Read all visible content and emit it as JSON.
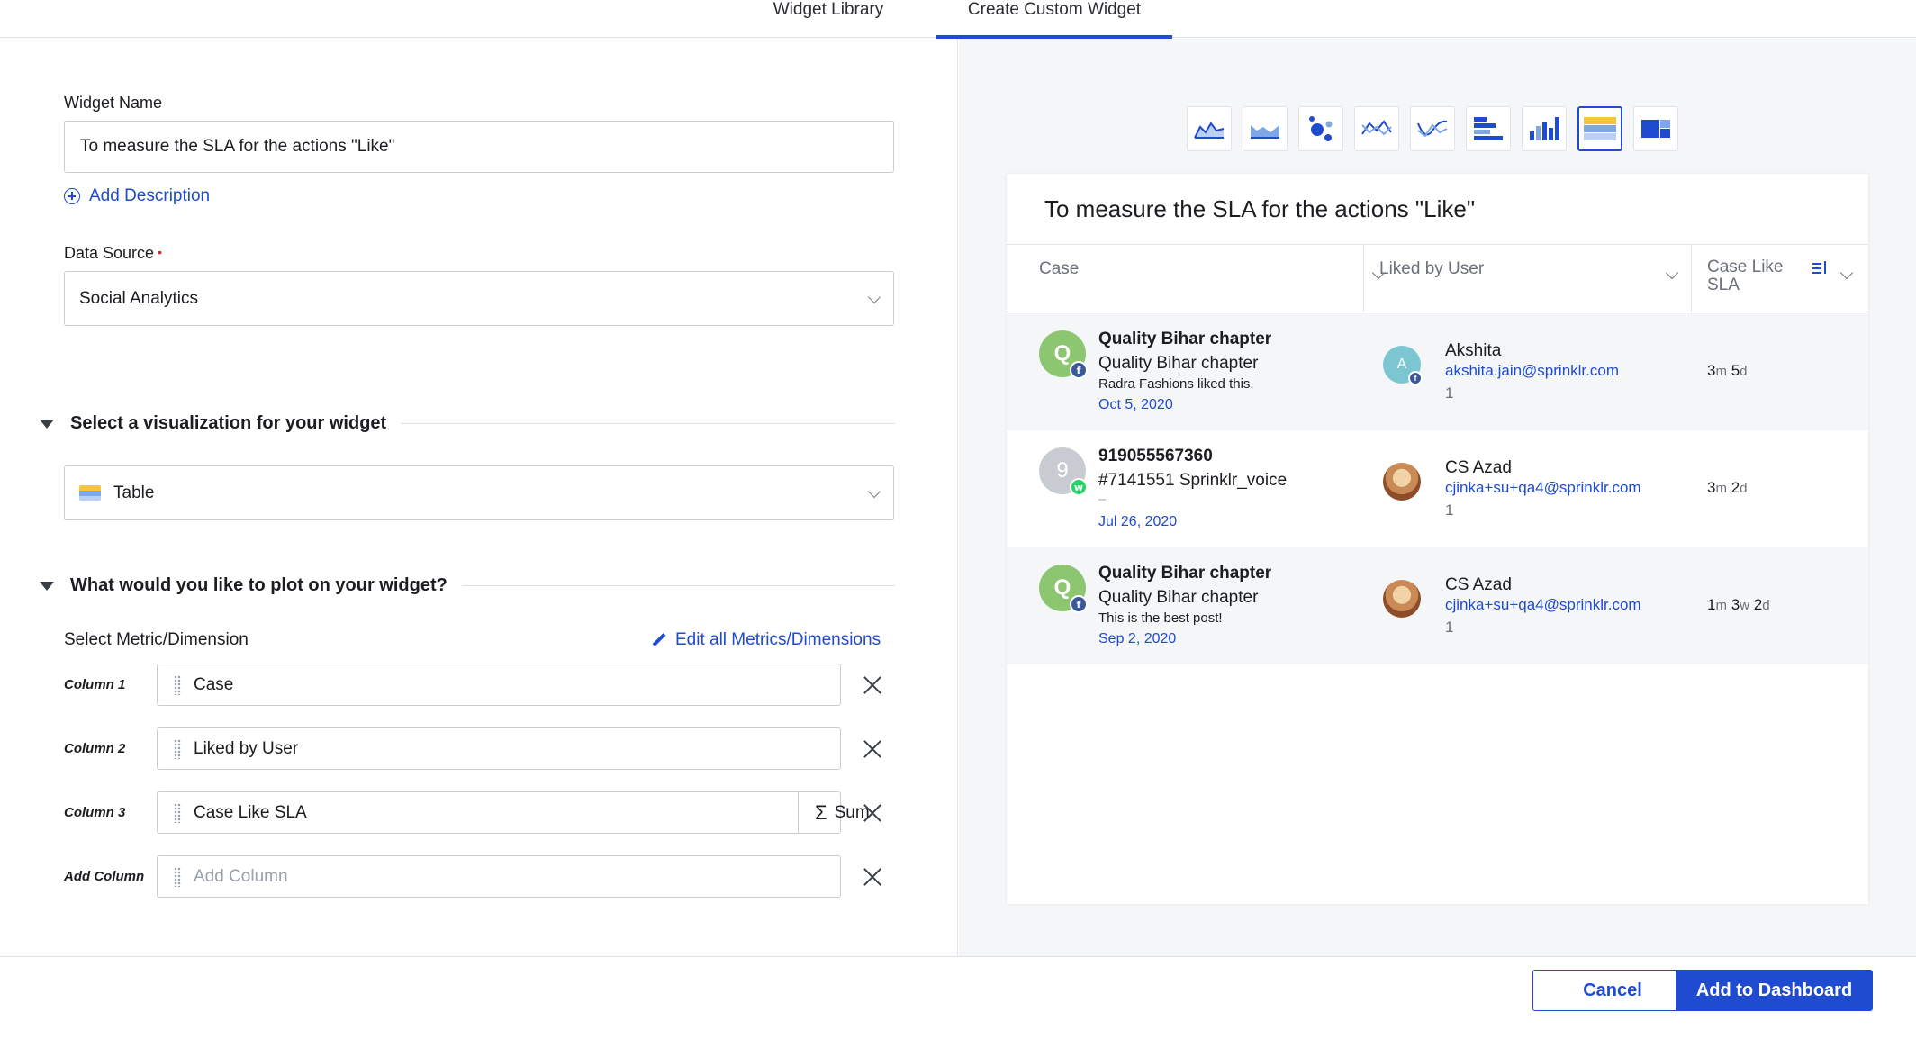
{
  "tabs": [
    {
      "label": "Widget Library"
    },
    {
      "label": "Create Custom Widget"
    }
  ],
  "form": {
    "widget_name_label": "Widget Name",
    "widget_name_value": "To measure the SLA for the actions \"Like\"",
    "add_description": "Add Description",
    "data_source_label": "Data Source",
    "data_source_required": "•",
    "data_source_value": "Social Analytics",
    "viz_section_title": "Select a visualization for your widget",
    "viz_value": "Table",
    "plot_section_title": "What would you like to plot on your widget?",
    "select_metric_label": "Select Metric/Dimension",
    "edit_all_link": "Edit all Metrics/Dimensions",
    "columns": [
      {
        "label": "Column 1",
        "value": "Case"
      },
      {
        "label": "Column 2",
        "value": "Liked by User"
      },
      {
        "label": "Column 3",
        "value": "Case Like SLA",
        "aggregation": "Sum",
        "aggregation_symbol": "Σ"
      },
      {
        "label": "Add Column",
        "placeholder": "Add Column"
      }
    ]
  },
  "preview": {
    "viz_icons": [
      "area-line-icon",
      "area-icon",
      "bubble-icon",
      "line-icon",
      "spline-icon",
      "horizontal-bar-icon",
      "column-icon",
      "table-icon",
      "treemap-icon"
    ],
    "active_viz": "table-icon",
    "title": "To measure the SLA for the actions \"Like\"",
    "headers": [
      "Case",
      "Liked by User",
      "Case Like SLA"
    ],
    "rows": [
      {
        "avatar_letter": "Q",
        "avatar_color": "#8dc671",
        "channel": "f",
        "case_name": "Quality Bihar chapter",
        "case_sub": "Quality Bihar chapter",
        "case_msg": "Radra Fashions liked this.",
        "case_date": "Oct 5, 2020",
        "user_avatar": "A",
        "user_name": "Akshita",
        "user_email": "akshita.jain@sprinklr.com",
        "count": "1",
        "sla": [
          {
            "n": "3",
            "u": "m"
          },
          {
            "n": "5",
            "u": "d"
          }
        ]
      },
      {
        "avatar_letter": "9",
        "avatar_color": "#c8cbd1",
        "channel": "w",
        "case_name": "919055567360",
        "case_sub": "#7141551 Sprinklr_voice",
        "case_msg": "–",
        "case_date": "Jul 26, 2020",
        "user_avatar": "",
        "user_name": "CS Azad",
        "user_email": "cjinka+su+qa4@sprinklr.com",
        "count": "1",
        "sla": [
          {
            "n": "3",
            "u": "m"
          },
          {
            "n": "2",
            "u": "d"
          }
        ]
      },
      {
        "avatar_letter": "Q",
        "avatar_color": "#8dc671",
        "channel": "f",
        "case_name": "Quality Bihar chapter",
        "case_sub": "Quality Bihar chapter",
        "case_msg": "This is the best post!",
        "case_date": "Sep 2, 2020",
        "user_avatar": "",
        "user_name": "CS Azad",
        "user_email": "cjinka+su+qa4@sprinklr.com",
        "count": "1",
        "sla": [
          {
            "n": "1",
            "u": "m"
          },
          {
            "n": "3",
            "u": "w"
          },
          {
            "n": "2",
            "u": "d"
          }
        ]
      }
    ]
  },
  "footer": {
    "cancel": "Cancel",
    "add": "Add to Dashboard"
  },
  "colors": {
    "accent": "#1f4bd1",
    "required": "#d62b2b"
  }
}
